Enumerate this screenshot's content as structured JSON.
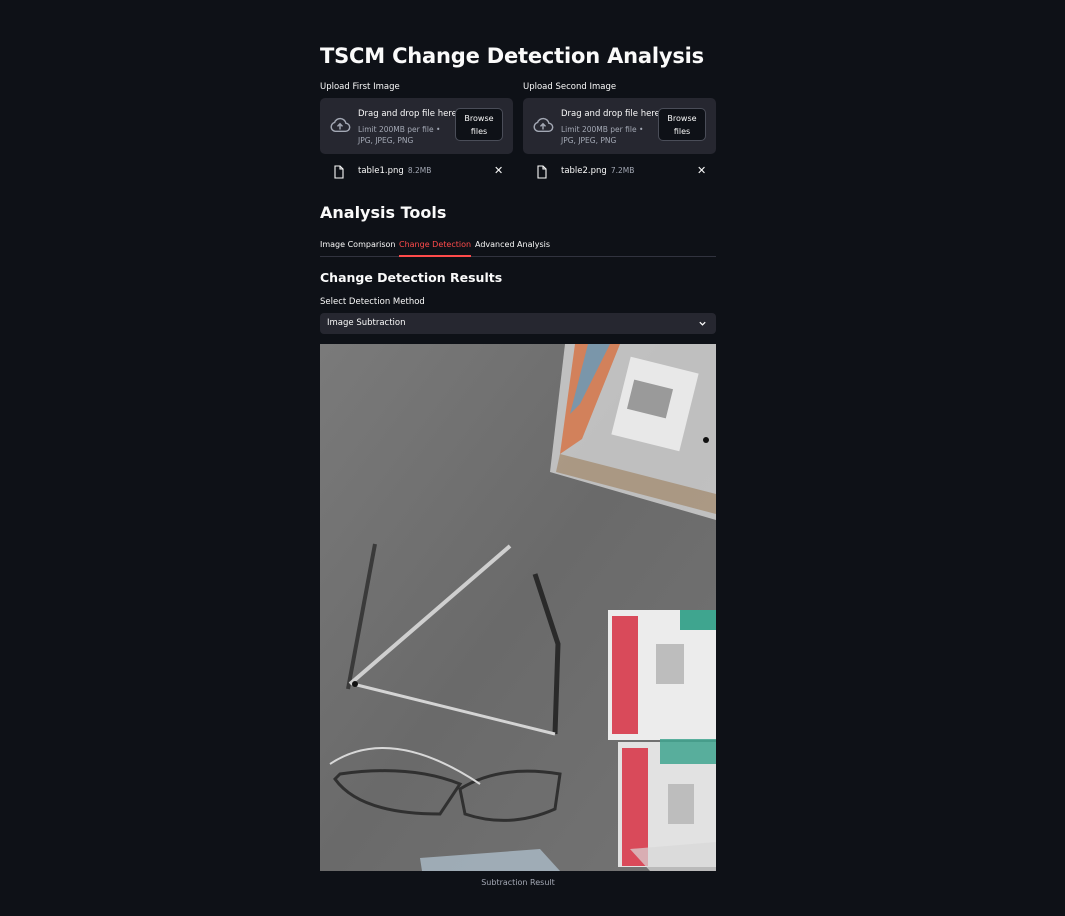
{
  "page": {
    "title": "TSCM Change Detection Analysis"
  },
  "uploaders": [
    {
      "label": "Upload First Image",
      "dropzone_title": "Drag and drop file here",
      "limit_text": "Limit 200MB per file • JPG, JPEG, PNG",
      "browse_label": "Browse files",
      "file_name": "table1.png",
      "file_size": "8.2MB"
    },
    {
      "label": "Upload Second Image",
      "dropzone_title": "Drag and drop file here",
      "limit_text": "Limit 200MB per file • JPG, JPEG, PNG",
      "browse_label": "Browse files",
      "file_name": "table2.png",
      "file_size": "7.2MB"
    }
  ],
  "analysis": {
    "heading": "Analysis Tools",
    "tabs": [
      {
        "label": "Image Comparison",
        "active": false
      },
      {
        "label": "Change Detection",
        "active": true
      },
      {
        "label": "Advanced Analysis",
        "active": false
      }
    ],
    "accent_color": "#ff4b4b"
  },
  "results": {
    "heading": "Change Detection Results",
    "select_label": "Select Detection Method",
    "selected_method": "Image Subtraction",
    "image_caption": "Subtraction Result"
  },
  "icons": {
    "upload": "cloud-upload-icon",
    "file": "file-icon",
    "remove": "close-icon",
    "dropdown": "chevron-down-icon"
  }
}
